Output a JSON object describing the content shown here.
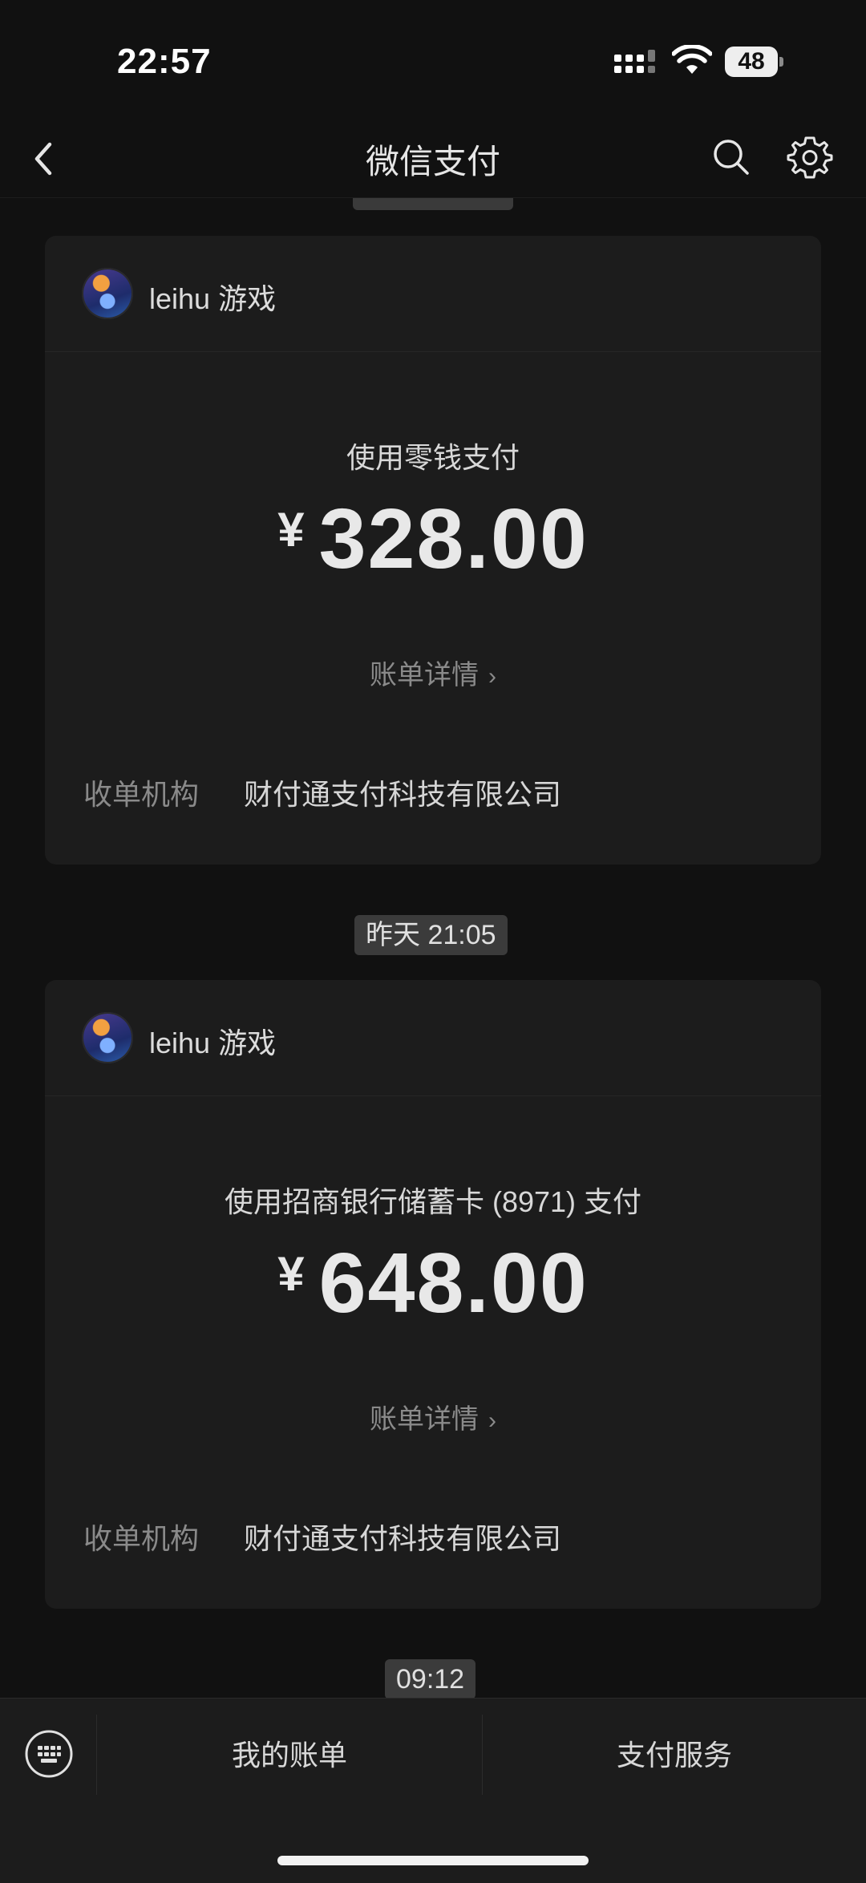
{
  "status_bar": {
    "time": "22:57",
    "battery": "48"
  },
  "nav": {
    "title": "微信支付",
    "back_icon": "chevron-left-icon",
    "search_icon": "search-icon",
    "settings_icon": "gear-icon"
  },
  "transactions": [
    {
      "merchant": "leihu 游戏",
      "pay_method": "使用零钱支付",
      "currency": "¥",
      "amount": "328.00",
      "detail_link": "账单详情",
      "acquirer_label": "收单机构",
      "acquirer_value": "财付通支付科技有限公司"
    },
    {
      "timestamp": "昨天 21:05",
      "merchant": "leihu 游戏",
      "pay_method": "使用招商银行储蓄卡 (8971) 支付",
      "currency": "¥",
      "amount": "648.00",
      "detail_link": "账单详情",
      "acquirer_label": "收单机构",
      "acquirer_value": "财付通支付科技有限公司"
    }
  ],
  "next_timestamp": "09:12",
  "bottom_menu": {
    "keyboard_icon": "keyboard-icon",
    "items": [
      "我的账单",
      "支付服务"
    ]
  },
  "colors": {
    "background": "#111111",
    "card": "#1c1c1c",
    "timestamp_badge": "#3b3b3b"
  }
}
